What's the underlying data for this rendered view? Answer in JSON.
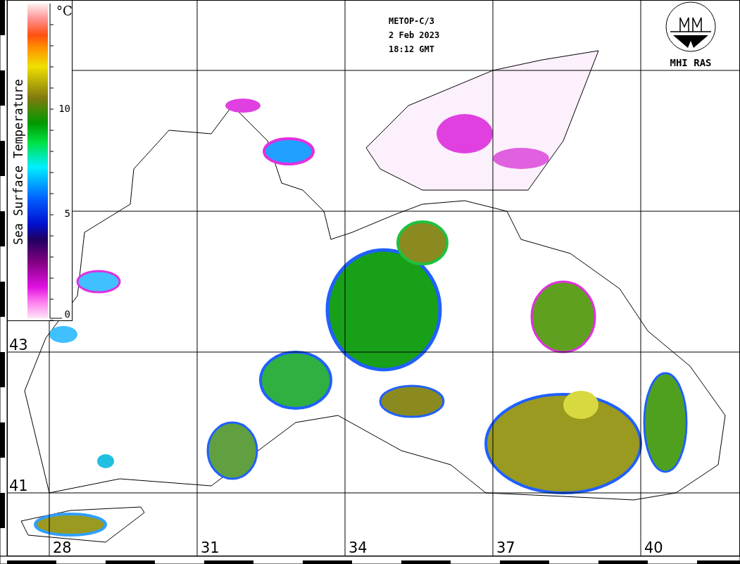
{
  "header": {
    "lines": [
      "METOP-C/3",
      "2 Feb 2023",
      "18:12 GMT"
    ]
  },
  "logo": {
    "label": "MHI RAS"
  },
  "colorbar": {
    "title": "Sea Surface Temperature",
    "unit": "°C",
    "ticks": [
      "10",
      "5",
      "0"
    ]
  },
  "map": {
    "latitude_labels": [
      "43",
      "41"
    ],
    "longitude_labels": [
      "28",
      "31",
      "34",
      "37",
      "40"
    ]
  }
}
